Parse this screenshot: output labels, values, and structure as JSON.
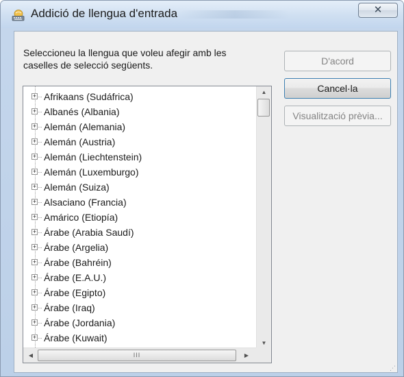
{
  "window": {
    "title": "Addició de llengua d'entrada",
    "close_label": "✕",
    "app_icon": "keyboard-globe-icon"
  },
  "dialog": {
    "instruction": "Seleccioneu la llengua que voleu afegir amb les caselles de selecció següents.",
    "buttons": {
      "ok_label": "D'acord",
      "ok_enabled": false,
      "cancel_label": "Cancel·la",
      "preview_label": "Visualització prèvia...",
      "preview_enabled": false
    }
  },
  "language_list": {
    "expander_glyph": "+",
    "items": [
      "Afrikaans (Sudáfrica)",
      "Albanés (Albania)",
      "Alemán (Alemania)",
      "Alemán (Austria)",
      "Alemán (Liechtenstein)",
      "Alemán (Luxemburgo)",
      "Alemán (Suiza)",
      "Alsaciano (Francia)",
      "Amárico (Etiopía)",
      "Árabe (Arabia Saudí)",
      "Árabe (Argelia)",
      "Árabe (Bahréin)",
      "Árabe (E.A.U.)",
      "Árabe (Egipto)",
      "Árabe (Iraq)",
      "Árabe (Jordania)",
      "Árabe (Kuwait)"
    ]
  },
  "scrollbars": {
    "up_arrow": "▲",
    "down_arrow": "▼",
    "left_arrow": "◀",
    "right_arrow": "▶",
    "thumb_grip": "III",
    "vertical_position": 0
  },
  "colors": {
    "title_bar": "#c2d6ee",
    "dialog_background": "#f0f0f0",
    "list_background": "#ffffff"
  }
}
